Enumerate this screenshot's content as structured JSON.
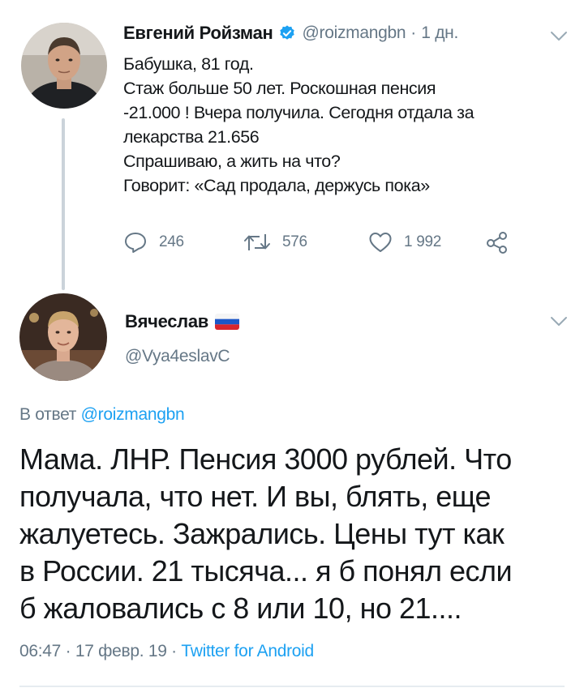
{
  "parent_tweet": {
    "author_name": "Евгений Ройзман",
    "handle": "@roizmangbn",
    "separator": "·",
    "time_ago": "1 дн.",
    "verified": true,
    "text_lines": [
      "Бабушка, 81 год.",
      "Стаж больше 50 лет. Роскошная пенсия",
      "-21.000 ! Вчера получила. Сегодня отдала за",
      "лекарства 21.656",
      "Спрашиваю, а жить на что?",
      "Говорит: «Сад продала, держусь пока»"
    ],
    "actions": {
      "reply_count": "246",
      "retweet_count": "576",
      "like_count": "1 992"
    },
    "icons": [
      "verified-badge-icon",
      "chevron-down-icon",
      "reply-icon",
      "retweet-icon",
      "like-icon",
      "share-icon"
    ]
  },
  "reply_tweet": {
    "author_name": "Вячеслав",
    "flag": "russian-flag-emoji",
    "handle": "@Vya4eslavC",
    "reply_prefix": "В ответ",
    "reply_mention": "@roizmangbn",
    "text_lines": [
      "Мама. ЛНР. Пенсия 3000 рублей. Что",
      "получала, что нет. И вы, блять, еще",
      "жалуетесь. Зажрались. Цены тут как",
      "в России. 21 тысяча... я б понял если",
      "б жаловались с 8 или 10, но 21...."
    ],
    "time": "06:47",
    "date": "17 февр. 19",
    "separator": "·",
    "source": "Twitter for Android"
  },
  "colors": {
    "text": "#14171a",
    "secondary": "#657786",
    "accent": "#1da1f2",
    "thread_line": "#cbd3da"
  }
}
